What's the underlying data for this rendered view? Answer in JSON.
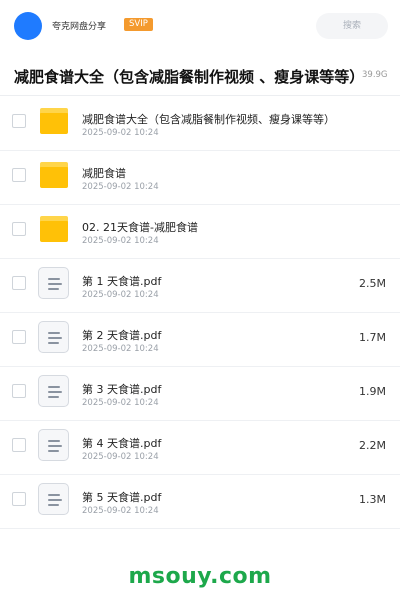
{
  "header": {
    "share_name": "夸克网盘分享",
    "badge": "SVIP",
    "search_label": "搜索"
  },
  "folder": {
    "title": "减肥食谱大全（包含减脂餐制作视频 、瘦身课等等）",
    "size": "39.9G"
  },
  "files": [
    {
      "name": "减肥食谱大全（包含减脂餐制作视频、瘦身课等等）",
      "date": "2025-09-02 10:24",
      "size": "",
      "type": "folder"
    },
    {
      "name": "减肥食谱",
      "date": "2025-09-02 10:24",
      "size": "",
      "type": "folder"
    },
    {
      "name": "02. 21天食谱-减肥食谱",
      "date": "2025-09-02 10:24",
      "size": "",
      "type": "folder"
    },
    {
      "name": "第 1 天食谱.pdf",
      "date": "2025-09-02 10:24",
      "size": "2.5M",
      "type": "file"
    },
    {
      "name": "第 2 天食谱.pdf",
      "date": "2025-09-02 10:24",
      "size": "1.7M",
      "type": "file"
    },
    {
      "name": "第 3 天食谱.pdf",
      "date": "2025-09-02 10:24",
      "size": "1.9M",
      "type": "file"
    },
    {
      "name": "第 4 天食谱.pdf",
      "date": "2025-09-02 10:24",
      "size": "2.2M",
      "type": "file"
    },
    {
      "name": "第 5 天食谱.pdf",
      "date": "2025-09-02 10:24",
      "size": "1.3M",
      "type": "file"
    }
  ],
  "watermark": "msouy.com",
  "colors": {
    "avatar": "#1f7bff",
    "svip_badge": "#f49a2e",
    "folder": "#ffc107",
    "watermark": "#1da84b"
  }
}
